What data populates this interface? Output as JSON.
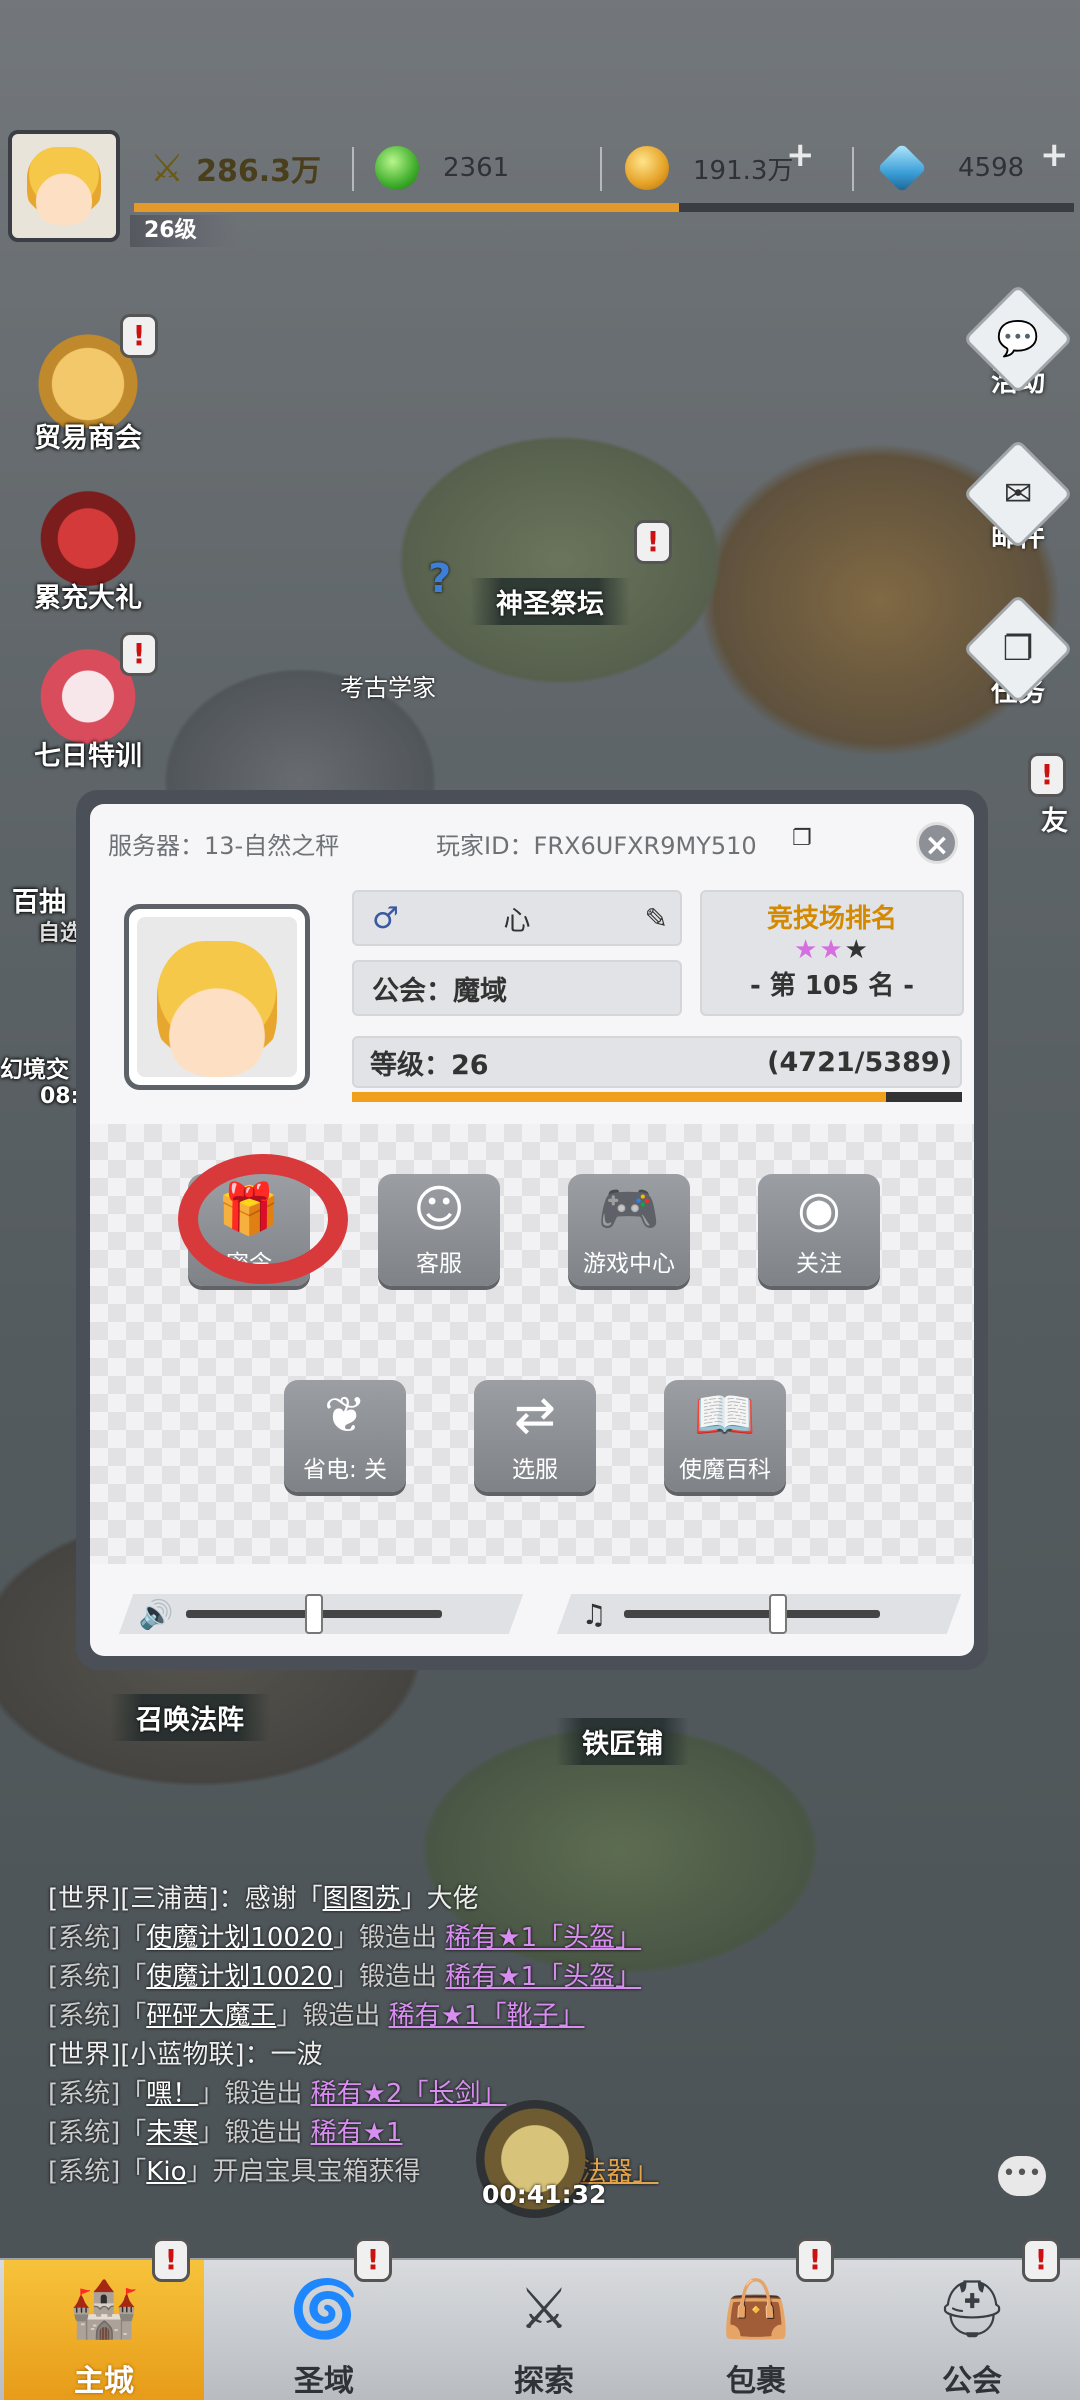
{
  "top": {
    "level": "26级",
    "power": "286.3万",
    "gems": "2361",
    "gold": "191.3万",
    "diamonds": "4598"
  },
  "left_side": [
    {
      "label": "贸易商会"
    },
    {
      "label": "累充大礼"
    },
    {
      "label": "七日特训"
    },
    {
      "label": "百抽"
    },
    {
      "label": "自选"
    },
    {
      "label": "幻境交"
    },
    {
      "label": "08:"
    }
  ],
  "right_menu": [
    {
      "label": "活动"
    },
    {
      "label": "邮件"
    },
    {
      "label": "任务"
    },
    {
      "label": "友"
    }
  ],
  "map_labels": {
    "altar": "神圣祭坛",
    "archaeologist": "考古学家",
    "summon": "召唤法阵",
    "smithy": "铁匠铺"
  },
  "profile": {
    "server": "服务器：13-自然之秤",
    "player_id": "玩家ID：FRX6UFXR9MY510",
    "name": "心",
    "guild": "公会：魔域",
    "arena_title": "竞技场排名",
    "arena_rank": "- 第 105 名 -",
    "level": "等级：26",
    "exp": "(4721/5389)",
    "exp_fraction": 0.876,
    "buttons": [
      {
        "label": "密令"
      },
      {
        "label": "客服"
      },
      {
        "label": "游戏中心"
      },
      {
        "label": "关注"
      },
      {
        "label": "省电: 关"
      },
      {
        "label": "选服"
      },
      {
        "label": "使魔百科"
      }
    ],
    "sound_volume": 0.5,
    "music_volume": 0.6
  },
  "chat": [
    {
      "ch": "[世界][三浦茜]：感谢「",
      "u": "图图苏",
      "rest": "」大佬",
      "rare": ""
    },
    {
      "ch": "[系统]「",
      "u": "使魔计划10020",
      "rest": "」锻造出",
      "rare": "稀有★1「头盔」"
    },
    {
      "ch": "[系统]「",
      "u": "使魔计划10020",
      "rest": "」锻造出",
      "rare": "稀有★1「头盔」"
    },
    {
      "ch": "[系统]「",
      "u": "砰砰大魔王",
      "rest": "」锻造出",
      "rare": "稀有★1「靴子」"
    },
    {
      "ch": "[世界][小蓝物联]：一波",
      "u": "",
      "rest": "",
      "rare": ""
    },
    {
      "ch": "[系统]「",
      "u": "嘿！",
      "rest": "」锻造出",
      "rare": "稀有★2「长剑」"
    },
    {
      "ch": "[系统]「",
      "u": "未寒",
      "rest": "」锻造出",
      "rare": "稀有★1"
    },
    {
      "ch": "[系统]「",
      "u": "Kio",
      "rest": "」开启宝具宝箱获得",
      "rare": "法器」"
    }
  ],
  "chest_timer": "00:41:32",
  "nav": [
    {
      "label": "主城"
    },
    {
      "label": "圣域"
    },
    {
      "label": "探索"
    },
    {
      "label": "包裹"
    },
    {
      "label": "公会"
    }
  ]
}
